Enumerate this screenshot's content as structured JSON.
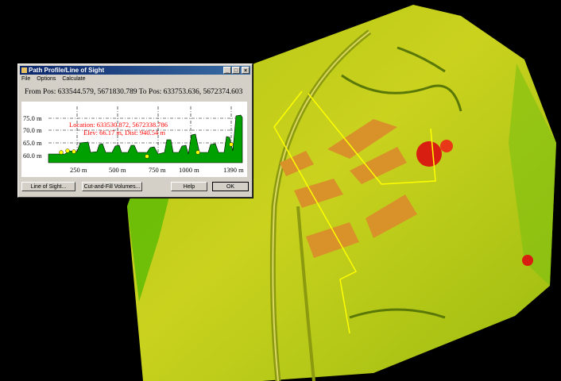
{
  "dialog": {
    "title": "Path Profile/Line of Sight",
    "menu": [
      "File",
      "Options",
      "Calculate"
    ],
    "from_to": "From Pos: 633544.579, 5671830.789 To Pos: 633753.636, 5672374.603",
    "location": "Location: 633530.872, 5672338.786",
    "elev_dist": "Elev: 66.17 m, Dist: 940.54 m",
    "y_ticks": [
      "75.0 m",
      "70.0 m",
      "65.0 m",
      "60.0 m"
    ],
    "x_ticks": [
      "250 m",
      "500 m",
      "750 m",
      "1000 m",
      "1390 m"
    ],
    "buttons": {
      "line_of_sight": "Line of Sight...",
      "cut_fill": "Cut-and-Fill Volumes...",
      "help": "Help",
      "ok": "OK"
    },
    "title_buttons": {
      "minimize": "_",
      "maximize": "□",
      "close": "×"
    }
  },
  "colors": {
    "profile_fill": "#00a000",
    "annotation": "#ff0000",
    "path_line": "#ffff00"
  }
}
